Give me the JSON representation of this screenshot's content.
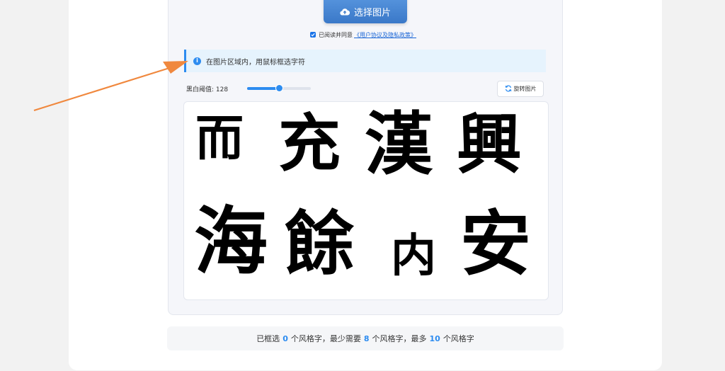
{
  "upload": {
    "label": "选择图片",
    "icon": "cloud-upload-icon"
  },
  "agreement": {
    "checked": true,
    "text": "已阅读并同意",
    "link": "《用户协议及隐私政策》"
  },
  "info": {
    "text": "在图片区域内，用鼠标框选字符",
    "icon": "info-icon"
  },
  "threshold": {
    "label": "黑白阈值: 128",
    "value": 128,
    "min": 0,
    "max": 255
  },
  "rotate": {
    "label": "旋转图片",
    "icon": "rotate-icon"
  },
  "image_chars": [
    "而",
    "充",
    "漢",
    "興",
    "海",
    "餘",
    "内",
    "安"
  ],
  "status": {
    "p1": "已框选",
    "selected": "0",
    "p2": "个风格字，最少需要",
    "min": "8",
    "p3": "个风格字，最多",
    "max": "10",
    "p4": "个风格字"
  },
  "colors": {
    "accent": "#2d8cf0",
    "annotation_arrow": "#f0883e"
  }
}
